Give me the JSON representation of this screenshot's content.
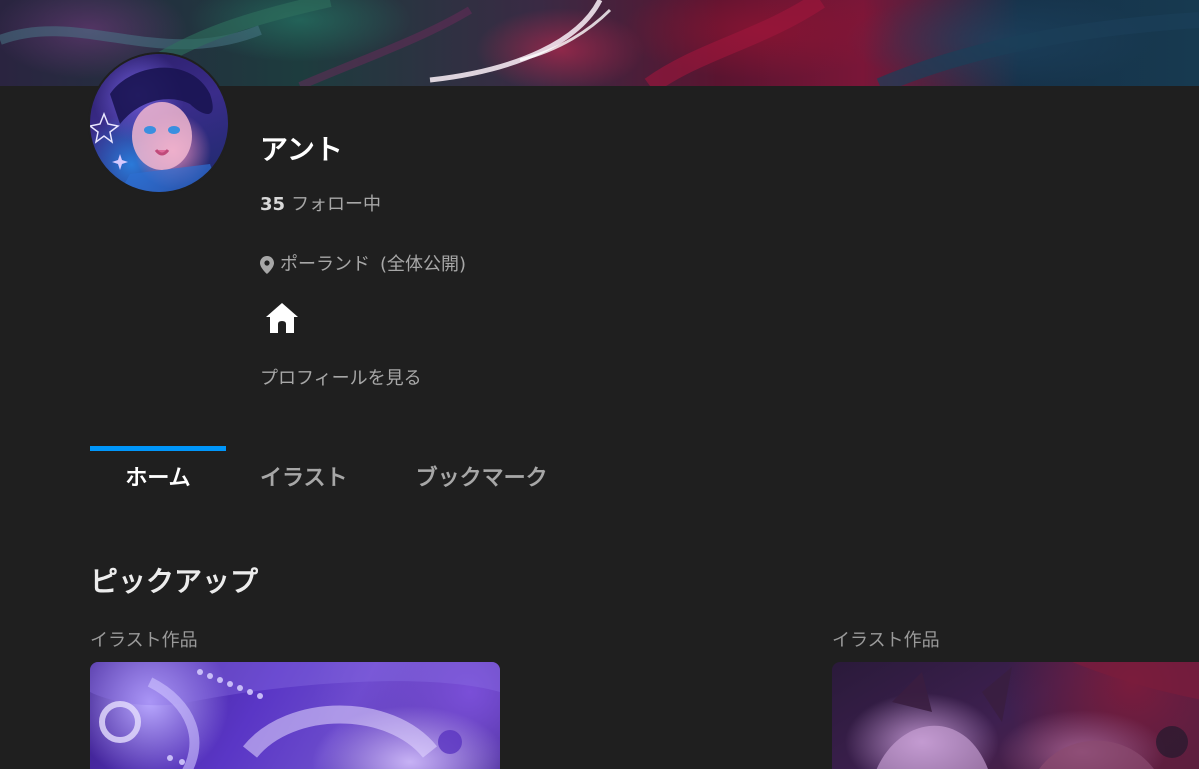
{
  "profile": {
    "name": "アント",
    "following_count": "35",
    "following_label": "フォロー中",
    "location": "ポーランド",
    "location_visibility": "(全体公開)",
    "view_profile_link": "プロフィールを見る"
  },
  "tabs": [
    {
      "label": "ホーム",
      "active": true
    },
    {
      "label": "イラスト",
      "active": false
    },
    {
      "label": "ブックマーク",
      "active": false
    }
  ],
  "pickup": {
    "title": "ピックアップ",
    "items": [
      {
        "type_label": "イラスト作品"
      },
      {
        "type_label": "イラスト作品"
      }
    ]
  },
  "theme": {
    "background": "#1f1f1f",
    "accent": "#0096fa",
    "text_primary": "#ffffff",
    "text_secondary": "#a7a7a7"
  },
  "icons": {
    "location": "map-pin-icon",
    "home": "home-icon"
  }
}
